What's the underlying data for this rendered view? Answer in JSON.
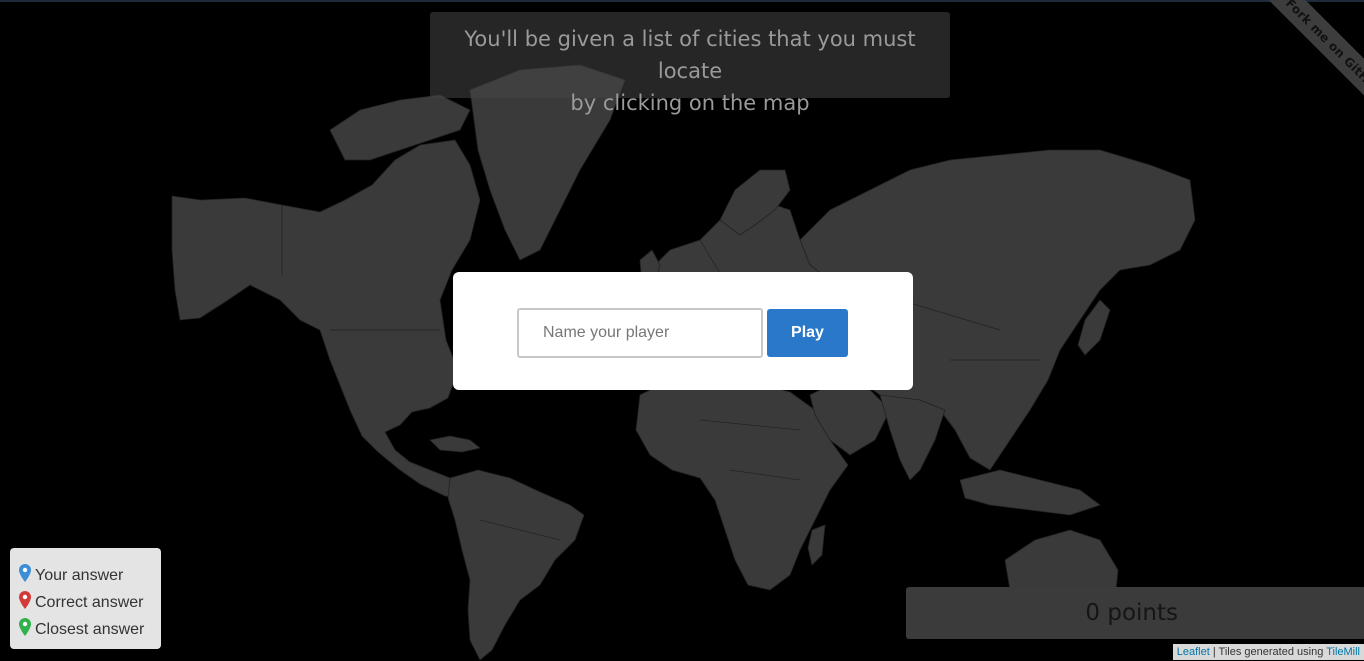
{
  "instructions": {
    "line1": "You'll be given a list of cities that you must locate",
    "line2": "by clicking on the map"
  },
  "ribbon": {
    "label": "Fork me on GitHub"
  },
  "modal": {
    "name_placeholder": "Name your player",
    "play_label": "Play"
  },
  "legend": {
    "items": [
      {
        "label": "Your answer",
        "color": "#3a8fd6",
        "icon": "map-marker-icon"
      },
      {
        "label": "Correct answer",
        "color": "#d43a3a",
        "icon": "map-marker-icon"
      },
      {
        "label": "Closest answer",
        "color": "#2fb24a",
        "icon": "map-marker-icon"
      }
    ]
  },
  "score": {
    "text": "0 points"
  },
  "attribution": {
    "leaflet": "Leaflet",
    "separator": " | Tiles generated using ",
    "tilemill": "TileMill"
  },
  "colors": {
    "land": "#3a3a3a",
    "ocean": "#000000",
    "play_button": "#2a78c9"
  }
}
